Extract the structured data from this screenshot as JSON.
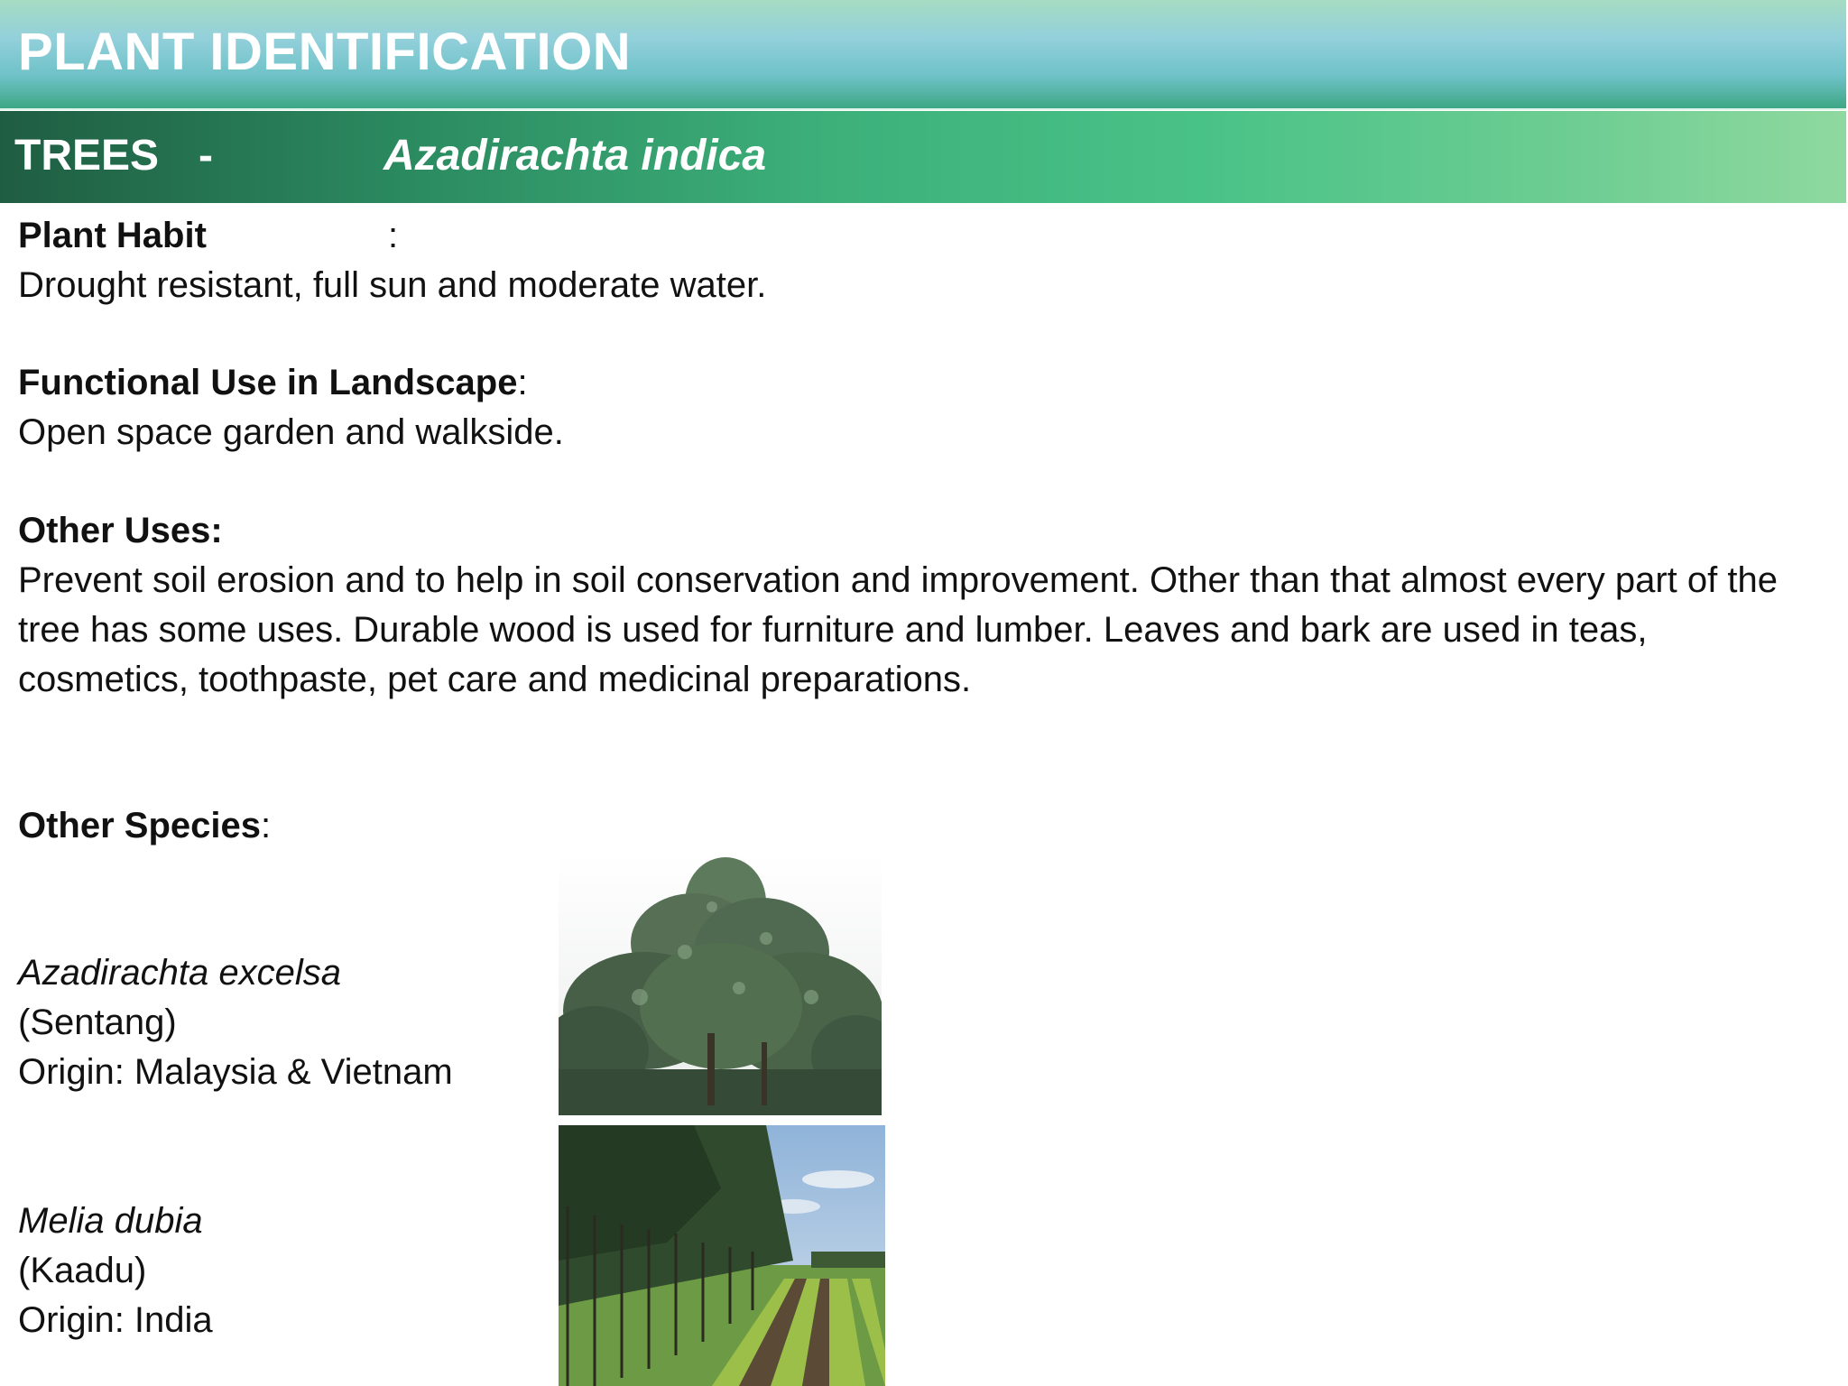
{
  "header": {
    "title": "PLANT IDENTIFICATION"
  },
  "subheader": {
    "category": "TREES",
    "separator": "-",
    "species": "Azadirachta indica"
  },
  "plant_habit": {
    "label": "Plant Habit",
    "colon": ":",
    "text": "Drought resistant, full sun and moderate water."
  },
  "functional_use": {
    "label": "Functional Use in Landscape",
    "colon": ":",
    "text": "Open space garden and walkside."
  },
  "other_uses": {
    "label": "Other Uses:",
    "text": "Prevent soil erosion and to help in soil conservation and improvement. Other than that almost every part of the tree has some uses. Durable wood is used for furniture and lumber. Leaves and bark are used in teas, cosmetics, toothpaste, pet care and medicinal preparations."
  },
  "other_species": {
    "label": "Other Species",
    "colon": ":",
    "items": [
      {
        "scientific_name": "Azadirachta excelsa",
        "common_name": "(Sentang)",
        "origin": "Origin: Malaysia & Vietnam"
      },
      {
        "scientific_name": "Melia dubia",
        "common_name": "(Kaadu)",
        "origin": "Origin: India"
      }
    ]
  }
}
